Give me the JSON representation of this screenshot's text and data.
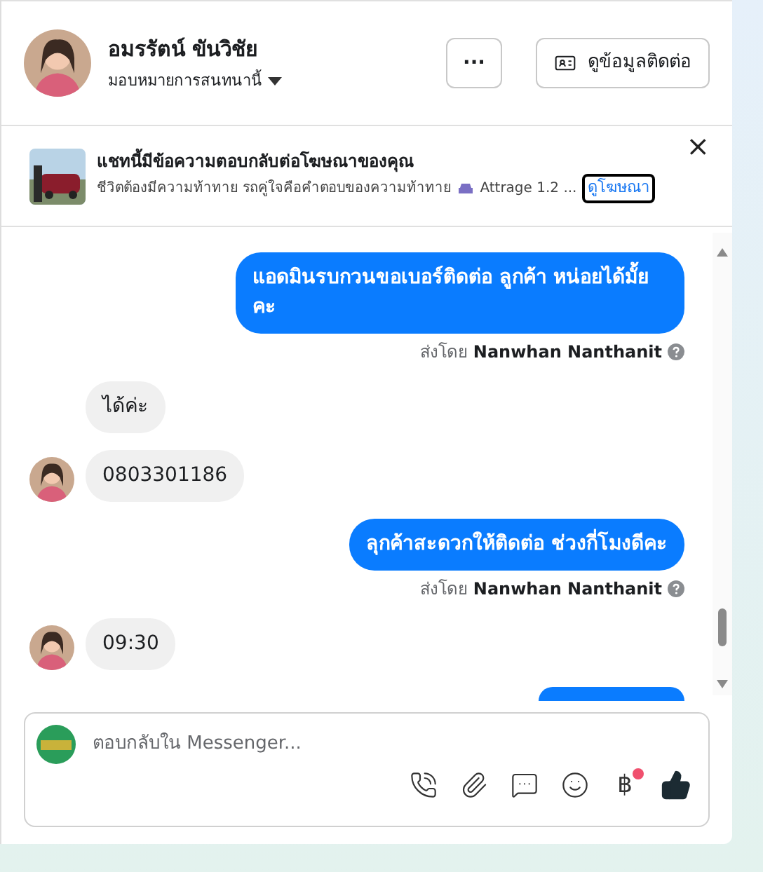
{
  "header": {
    "name": "อมรรัตน์ ขันวิชัย",
    "assign_label": "มอบหมายการสนทนานี้",
    "more_button": "···",
    "contact_button": "ดูข้อมูลติดต่อ"
  },
  "ad_banner": {
    "title": "แชทนี้มีข้อความตอบกลับต่อโฆษณาของคุณ",
    "description": "ชีวิตต้องมีความท้าทาย รถคู่ใจคือคำตอบของความท้าทาย",
    "product": "Attrage 1.2 ...",
    "link": "ดูโฆษณา",
    "close": "×"
  },
  "messages": [
    {
      "kind": "outgoing",
      "text": "แอดมินรบกวนขอเบอร์ติดต่อ ลูกค้า หน่อยได้มั้ยคะ",
      "sent_by_prefix": "ส่งโดย",
      "sent_by_name": "Nanwhan Nanthanit"
    },
    {
      "kind": "incoming",
      "text": "ได้ค่ะ",
      "show_avatar": false
    },
    {
      "kind": "incoming",
      "text": "0803301186",
      "show_avatar": true
    },
    {
      "kind": "outgoing",
      "text": "ลุกค้าสะดวกให้ติดต่อ ช่วงกี่โมงดีคะ",
      "sent_by_prefix": "ส่งโดย",
      "sent_by_name": "Nanwhan Nanthanit"
    },
    {
      "kind": "incoming",
      "text": "09:30",
      "show_avatar": true
    },
    {
      "kind": "outgoing_cut"
    }
  ],
  "composer": {
    "placeholder": "ตอบกลับใน Messenger...",
    "currency_symbol": "฿",
    "currency_badge": true
  }
}
